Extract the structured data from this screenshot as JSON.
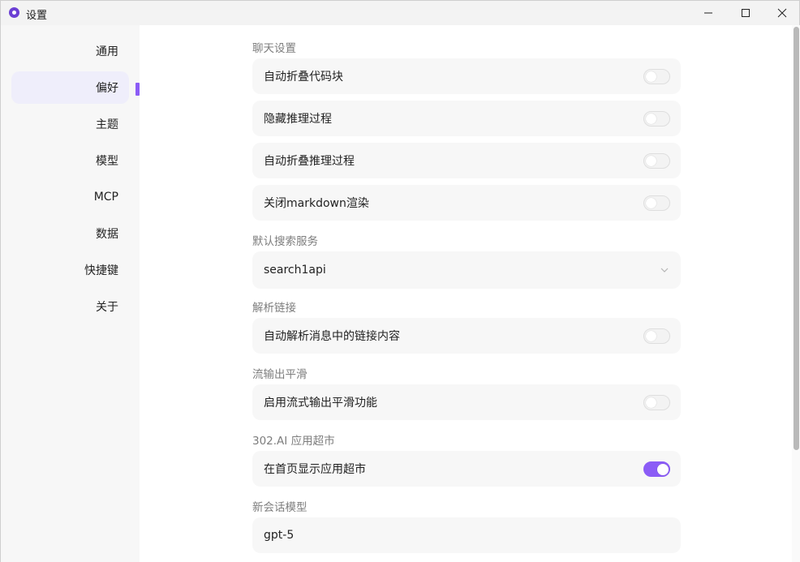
{
  "window": {
    "title": "设置"
  },
  "sidebar": {
    "items": [
      {
        "label": "通用"
      },
      {
        "label": "偏好"
      },
      {
        "label": "主题"
      },
      {
        "label": "模型"
      },
      {
        "label": "MCP"
      },
      {
        "label": "数据"
      },
      {
        "label": "快捷键"
      },
      {
        "label": "关于"
      }
    ],
    "active_index": 1
  },
  "main": {
    "sections": {
      "chat": {
        "title": "聊天设置",
        "options": [
          {
            "label": "自动折叠代码块",
            "enabled": false
          },
          {
            "label": "隐藏推理过程",
            "enabled": false
          },
          {
            "label": "自动折叠推理过程",
            "enabled": false
          },
          {
            "label": "关闭markdown渲染",
            "enabled": false
          }
        ]
      },
      "search": {
        "title": "默认搜索服务",
        "selected": "search1api"
      },
      "link": {
        "title": "解析链接",
        "option": {
          "label": "自动解析消息中的链接内容",
          "enabled": false
        }
      },
      "stream": {
        "title": "流输出平滑",
        "option": {
          "label": "启用流式输出平滑功能",
          "enabled": false
        }
      },
      "market": {
        "title": "302.AI 应用超市",
        "option": {
          "label": "在首页显示应用超市",
          "enabled": true
        }
      },
      "new_chat_model": {
        "title": "新会话模型",
        "selected": "gpt-5"
      }
    }
  },
  "colors": {
    "accent": "#8b5cf6",
    "active_nav_bg": "#efeefb"
  }
}
